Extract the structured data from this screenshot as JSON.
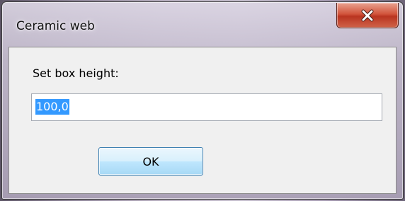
{
  "window": {
    "title": "Ceramic web",
    "close_icon": "close-icon"
  },
  "dialog": {
    "prompt": "Set box height:",
    "height_value": "100,0",
    "ok_label": "OK"
  },
  "colors": {
    "close_button": "#c7432b",
    "ok_button_border": "#3c7fb1",
    "selection": "#3399ff"
  }
}
